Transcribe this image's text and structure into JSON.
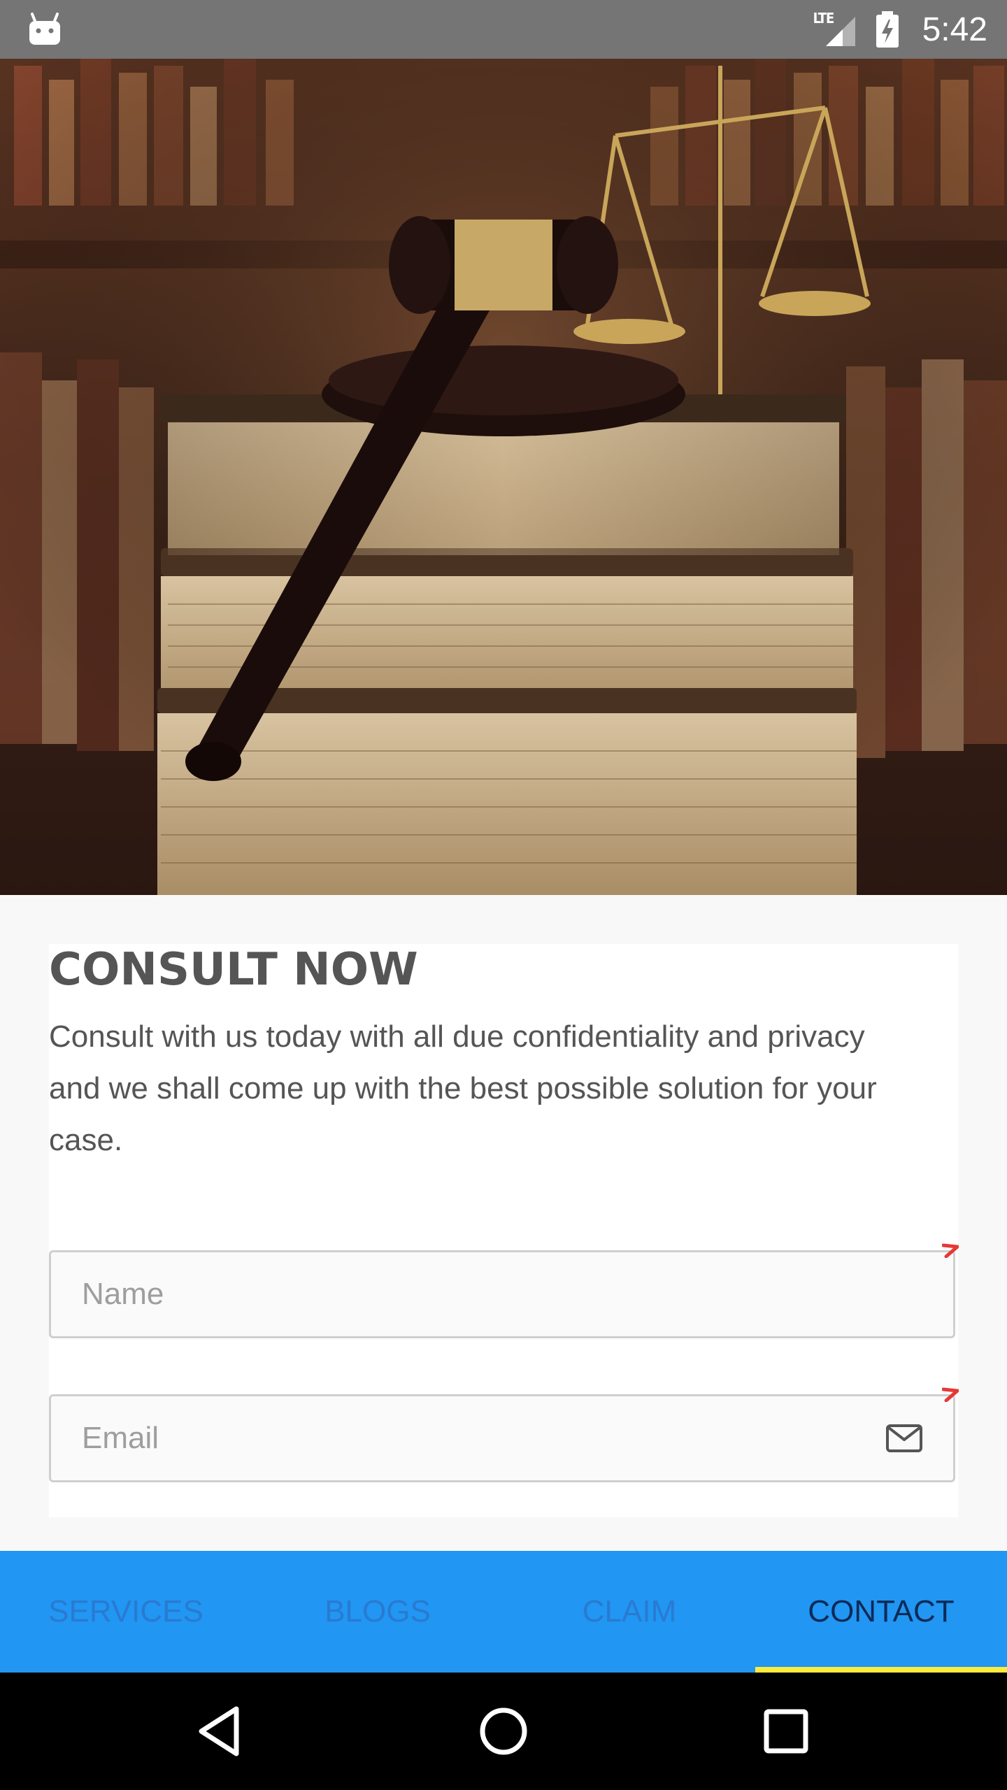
{
  "status_bar": {
    "time": "5:42",
    "network_label": "LTE",
    "icons": [
      "android-icon",
      "signal-icon",
      "battery-charging-icon"
    ]
  },
  "hero": {
    "image": "gavel-books-scales-photo"
  },
  "consult": {
    "title": "CONSULT NOW",
    "description": "Consult with us today with all due confidentiality and privacy and we shall come up with the best possible solution for your case.",
    "name_placeholder": "Name",
    "email_placeholder": "Email",
    "name_value": "",
    "email_value": ""
  },
  "tabs": [
    {
      "label": "SERVICES",
      "active": false
    },
    {
      "label": "BLOGS",
      "active": false
    },
    {
      "label": "CLAIM",
      "active": false
    },
    {
      "label": "CONTACT",
      "active": true
    }
  ],
  "colors": {
    "tabbar": "#2196f3",
    "tab_indicator": "#ffeb3b",
    "tab_inactive_text": "#2a7ad1",
    "tab_active_text": "#0d2a55",
    "required_mark": "#e53935"
  },
  "nav_icons": [
    "back-icon",
    "home-icon",
    "recents-icon"
  ]
}
